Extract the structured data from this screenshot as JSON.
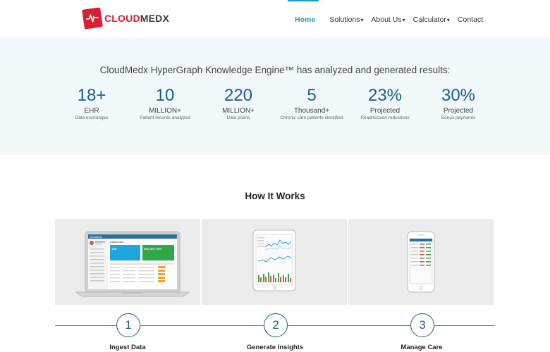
{
  "brand": {
    "logo_text_red": "CLOUD",
    "logo_text_dark": "MEDX",
    "accent": "#d71f36"
  },
  "nav": {
    "items": [
      {
        "label": "Home",
        "active": true
      },
      {
        "label": "Solutions",
        "dropdown": true
      },
      {
        "label": "About Us",
        "dropdown": true
      },
      {
        "label": "Calculator",
        "dropdown": true
      },
      {
        "label": "Contact"
      }
    ],
    "active_color": "#1a9bc1"
  },
  "stats": {
    "title": "CloudMedx HyperGraph Knowledge Engine™ has analyzed and generated results:",
    "items": [
      {
        "value": "18+",
        "unit": "EHR",
        "caption": "Data exchanges"
      },
      {
        "value": "10",
        "unit": "MILLION+",
        "caption": "Patient records analyzed"
      },
      {
        "value": "220",
        "unit": "MILLION+",
        "caption": "Data points"
      },
      {
        "value": "5",
        "unit": "Thousand+",
        "caption": "Chronic care patients identified"
      },
      {
        "value": "23%",
        "unit": "Projected",
        "caption": "Readmission reductions"
      },
      {
        "value": "30%",
        "unit": "Projected",
        "caption": "Bonus payments"
      }
    ]
  },
  "how": {
    "title": "How It Works",
    "steps": [
      {
        "number": "1",
        "label": "Ingest Data",
        "device": "laptop-dashboard"
      },
      {
        "number": "2",
        "label": "Generate Insights",
        "device": "tablet-charts"
      },
      {
        "number": "3",
        "label": "Manage Care",
        "device": "phone-list"
      }
    ]
  },
  "dashboard_mock": {
    "title": "Dashboard",
    "tile_1_value": "135",
    "tile_2_value": "$50 287,500"
  }
}
